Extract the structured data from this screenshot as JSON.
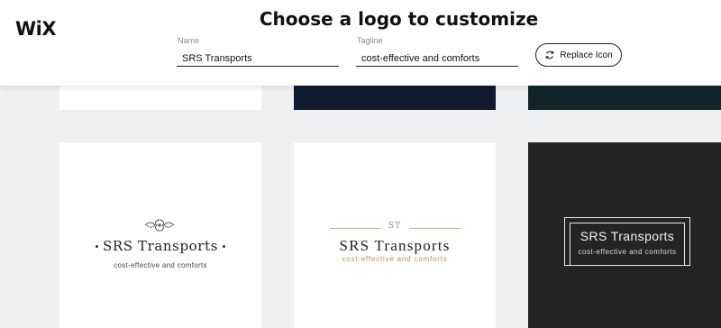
{
  "brand": {
    "logo_text": "WiX"
  },
  "header": {
    "title": "Choose a logo to customize",
    "name_label": "Name",
    "name_value": "SRS Transports",
    "tagline_label": "Tagline",
    "tagline_value": "cost-effective and comforts",
    "replace_icon_label": "Replace Icon"
  },
  "logos": [
    {
      "name": "SRS Transports",
      "tagline": "cost-effective and comforts",
      "style": "classic-ornament",
      "background": "#ffffff"
    },
    {
      "monogram": "ST",
      "name": "SRS Transports",
      "tagline": "cost-effective and comforts",
      "style": "serif-gold-lines",
      "background": "#ffffff"
    },
    {
      "name": "SRS Transports",
      "tagline": "cost-effective and comforts",
      "style": "framed-dark",
      "background": "#242424"
    }
  ],
  "partial_top_row_backgrounds": [
    "#ffffff",
    "#111a31",
    "#13262b"
  ],
  "icons": {
    "replace_button_icon": "refresh-icon",
    "ornament": "flourish-ornament-icon"
  },
  "colors": {
    "page_bg": "#eeeff1",
    "gold_accent": "#b39363"
  }
}
